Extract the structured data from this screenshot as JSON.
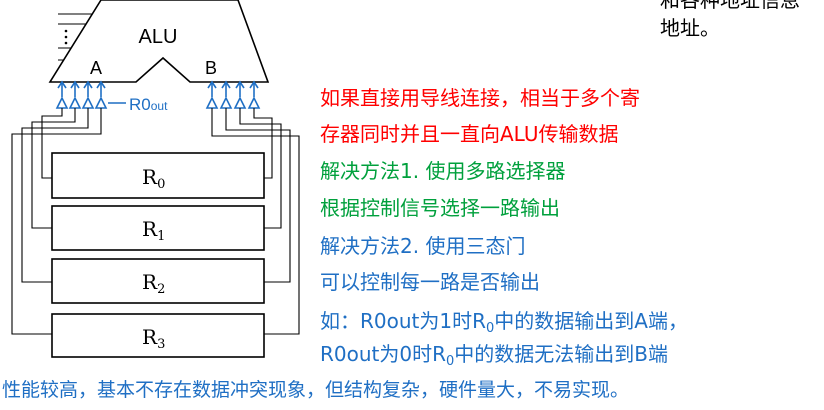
{
  "alu": {
    "label": "ALU",
    "port_a": "A",
    "port_b": "B"
  },
  "control": {
    "base": "R0",
    "sub": "out"
  },
  "registers": [
    {
      "base": "R",
      "sub": "0"
    },
    {
      "base": "R",
      "sub": "1"
    },
    {
      "base": "R",
      "sub": "2"
    },
    {
      "base": "R",
      "sub": "3"
    }
  ],
  "corner_text": {
    "line1": "和各种地址信息",
    "line2": "地址。"
  },
  "notes": {
    "problem_line1": "如果直接用导线连接，相当于多个寄",
    "problem_line2": "存器同时并且一直向ALU传输数据",
    "solution1_title": "解决方法1. 使用多路选择器",
    "solution1_desc": "根据控制信号选择一路输出",
    "solution2_title": "解决方法2. 使用三态门",
    "solution2_desc": "可以控制每一路是否输出",
    "example1_pre": "如：R0out为1时R",
    "example1_sub": "0",
    "example1_post": "中的数据输出到A端，",
    "example2_pre": "R0out为0时R",
    "example2_sub": "0",
    "example2_post": "中的数据无法输出到B端"
  },
  "footer": "性能较高，基本不存在数据冲突现象，但结构复杂，硬件量大，不易实现。"
}
